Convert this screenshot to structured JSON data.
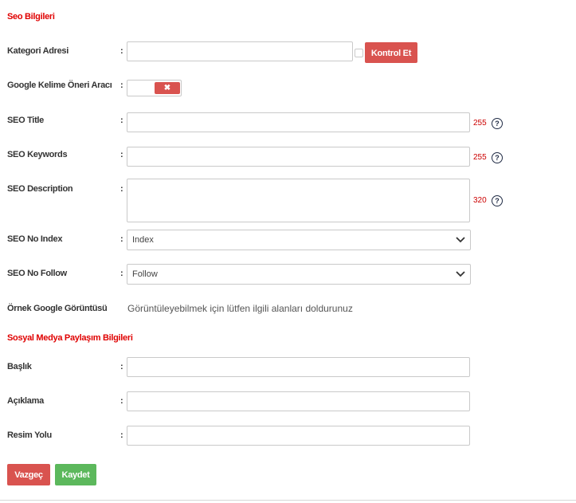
{
  "seo_section": {
    "title": "Seo Bilgileri"
  },
  "fields": {
    "category_url": {
      "label": "Kategori Adresi",
      "value": "",
      "check_button": "Kontrol Et"
    },
    "keyword_tool": {
      "label": "Google Kelime Öneri Aracı",
      "toggle_icon": "✖",
      "enabled": false
    },
    "seo_title": {
      "label": "SEO Title",
      "value": "",
      "limit": "255"
    },
    "seo_keywords": {
      "label": "SEO Keywords",
      "value": "",
      "limit": "255"
    },
    "seo_description": {
      "label": "SEO Description",
      "value": "",
      "limit": "320"
    },
    "seo_no_index": {
      "label": "SEO No Index",
      "selected": "Index"
    },
    "seo_no_follow": {
      "label": "SEO No Follow",
      "selected": "Follow"
    },
    "google_preview": {
      "label": "Örnek Google Görüntüsü",
      "text": "Görüntüleyebilmek için lütfen ilgili alanları doldurunuz"
    }
  },
  "social_section": {
    "title": "Sosyal Medya Paylaşım Bilgileri"
  },
  "social_fields": {
    "title": {
      "label": "Başlık",
      "value": ""
    },
    "description": {
      "label": "Açıklama",
      "value": ""
    },
    "image_path": {
      "label": "Resim Yolu",
      "value": ""
    }
  },
  "colon": ":",
  "help_glyph": "?",
  "actions": {
    "cancel": "Vazgeç",
    "save": "Kaydet"
  },
  "colors": {
    "danger": "#d9534f",
    "success": "#5cb85c",
    "section_title": "#e00000",
    "counter": "#cc0000"
  }
}
